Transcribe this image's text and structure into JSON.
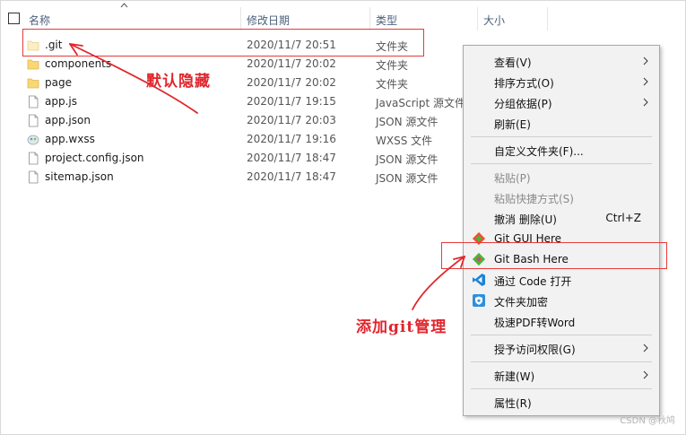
{
  "header": {
    "col_name": "名称",
    "col_date": "修改日期",
    "col_type": "类型",
    "col_size": "大小"
  },
  "files": [
    {
      "name": ".git",
      "date": "2020/11/7 20:51",
      "type": "文件夹",
      "icon": "folder-icon",
      "pale": true
    },
    {
      "name": "components",
      "date": "2020/11/7 20:02",
      "type": "文件夹",
      "icon": "folder-icon",
      "pale": false
    },
    {
      "name": "page",
      "date": "2020/11/7 20:02",
      "type": "文件夹",
      "icon": "folder-icon",
      "pale": false
    },
    {
      "name": "app.js",
      "date": "2020/11/7 19:15",
      "type": "JavaScript 源文件",
      "icon": "file-icon"
    },
    {
      "name": "app.json",
      "date": "2020/11/7 20:03",
      "type": "JSON 源文件",
      "icon": "file-icon"
    },
    {
      "name": "app.wxss",
      "date": "2020/11/7 19:16",
      "type": "WXSS 文件",
      "icon": "style-file-icon"
    },
    {
      "name": "project.config.json",
      "date": "2020/11/7 18:47",
      "type": "JSON 源文件",
      "icon": "file-icon"
    },
    {
      "name": "sitemap.json",
      "date": "2020/11/7 18:47",
      "type": "JSON 源文件",
      "icon": "file-icon"
    }
  ],
  "annotations": {
    "hidden_default": "默认隐藏",
    "git_added": "添加git管理"
  },
  "menu": {
    "view": "查看(V)",
    "sort_by": "排序方式(O)",
    "group_by": "分组依据(P)",
    "refresh": "刷新(E)",
    "customize_folder": "自定义文件夹(F)...",
    "paste": "粘贴(P)",
    "paste_shortcut": "粘贴快捷方式(S)",
    "undo_delete": "撤消 删除(U)",
    "undo_shortcut": "Ctrl+Z",
    "git_gui": "Git GUI Here",
    "git_bash": "Git Bash Here",
    "open_with_code": "通过 Code 打开",
    "encrypt_folder": "文件夹加密",
    "pdf_to_word": "极速PDF转Word",
    "grant_access": "授予访问权限(G)",
    "new": "新建(W)",
    "properties": "属性(R)"
  },
  "watermark": "CSDN @秋鸠",
  "colors": {
    "annotation_red": "#e0262d",
    "folder_yellow": "#f8d775",
    "vscode_blue": "#1a84d8",
    "git_orange": "#f05033",
    "git_green": "#48b63c"
  }
}
